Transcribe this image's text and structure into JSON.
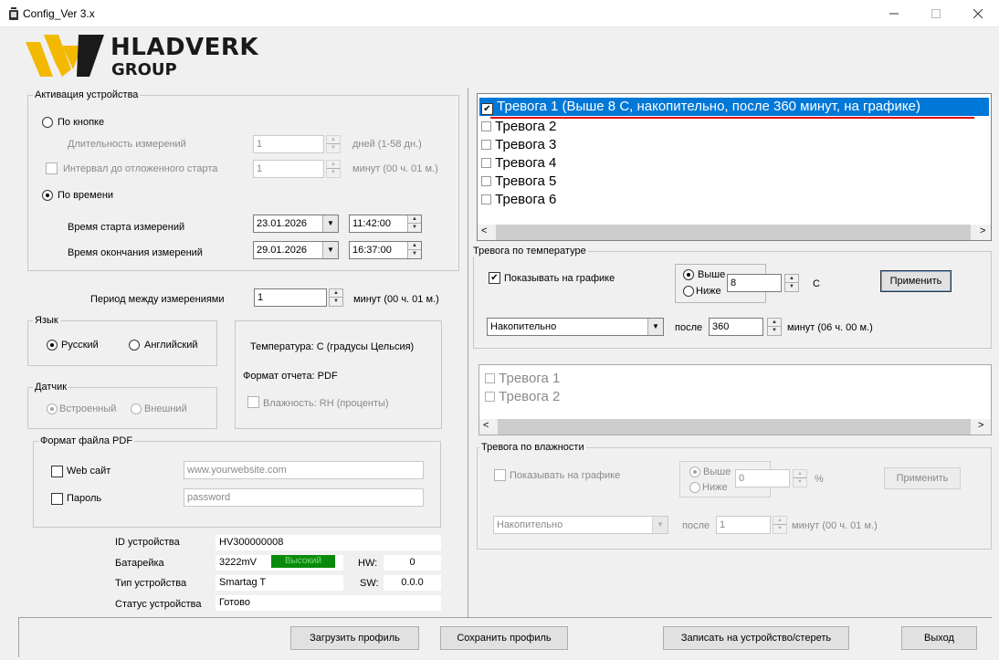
{
  "window": {
    "title": "Config_Ver 3.x"
  },
  "logo": {
    "line1": "HLADVERK",
    "line2": "GROUP"
  },
  "activation": {
    "title": "Активация устройства",
    "by_button": "По кнопке",
    "duration_label": "Длительность измерений",
    "duration_value": "1",
    "duration_unit": "дней (1-58 дн.)",
    "delay_label": "Интервал до отложенного старта",
    "delay_value": "1",
    "delay_unit": "минут (00 ч. 01 м.)",
    "by_time": "По времени",
    "start_label": "Время старта измерений",
    "start_date": "23.01.2026",
    "start_time": "11:42:00",
    "end_label": "Время окончания измерений",
    "end_date": "29.01.2026",
    "end_time": "16:37:00"
  },
  "period": {
    "label": "Период между измерениями",
    "value": "1",
    "unit": "минут (00 ч. 01 м.)"
  },
  "language": {
    "title": "Язык",
    "ru": "Русский",
    "en": "Английский"
  },
  "sensor": {
    "title": "Датчик",
    "builtin": "Встроенный",
    "external": "Внешний"
  },
  "info": {
    "temperature": "Температура: С (градусы Цельсия)",
    "report_format": "Формат отчета: PDF",
    "humidity": "Влажность: RH (проценты)"
  },
  "pdf": {
    "title": "Формат файла PDF",
    "website_label": "Web сайт",
    "website_placeholder": "www.yourwebsite.com",
    "password_label": "Пароль",
    "password_placeholder": "password"
  },
  "device": {
    "id_label": "ID устройства",
    "id_value": "HV300000008",
    "battery_label": "Батарейка",
    "battery_value": "3222mV",
    "battery_status": "Высокий",
    "hw_label": "HW:",
    "hw_value": "0",
    "type_label": "Тип устройства",
    "type_value": "Smartag T",
    "sw_label": "SW:",
    "sw_value": "0.0.0",
    "status_label": "Статус устройства",
    "status_value": "Готово"
  },
  "temp_alarms": {
    "items": [
      {
        "label": "Тревога 1 (Выше 8 С, накопительно, после 360 минут, на графике)",
        "checked": "✔"
      },
      {
        "label": "Тревога 2"
      },
      {
        "label": "Тревога 3"
      },
      {
        "label": "Тревога 4"
      },
      {
        "label": "Тревога 5"
      },
      {
        "label": "Тревога 6"
      }
    ]
  },
  "temp_settings": {
    "title": "Тревога по температуре",
    "show_on_chart": "Показывать на графике",
    "check_mark": "✔",
    "above": "Выше",
    "below": "Ниже",
    "threshold": "8",
    "unit": "С",
    "apply": "Применить",
    "mode": "Накопительно",
    "after_label": "после",
    "after_value": "360",
    "after_unit": "минут (06 ч. 00 м.)"
  },
  "hum_alarms": {
    "items": [
      {
        "label": "Тревога 1"
      },
      {
        "label": "Тревога 2"
      }
    ]
  },
  "hum_settings": {
    "title": "Тревога по влажности",
    "show_on_chart": "Показывать на графике",
    "above": "Выше",
    "below": "Ниже",
    "threshold": "0",
    "unit": "%",
    "apply": "Применить",
    "mode": "Накопительно",
    "after_label": "после",
    "after_value": "1",
    "after_unit": "минут (00 ч. 01 м.)"
  },
  "footer": {
    "load": "Загрузить профиль",
    "save": "Сохранить профиль",
    "write": "Записать на устройство/стереть",
    "exit": "Выход"
  },
  "colors": {
    "selection": "#0078d7",
    "battery_ok": "#0a8a0a",
    "annotation": "#e00000"
  }
}
